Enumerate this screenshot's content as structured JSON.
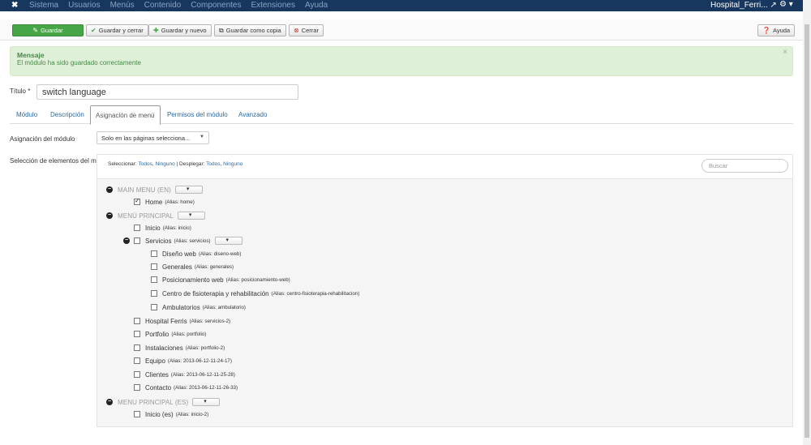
{
  "navbar": {
    "logo": "✖",
    "menu": [
      "Sistema",
      "Usuarios",
      "Menús",
      "Contenido",
      "Componentes",
      "Extensiones",
      "Ayuda"
    ],
    "site": "Hospital_Ferri... ↗",
    "gear": "⚙ ▾"
  },
  "toolbar": {
    "save": "Guardar",
    "save_close": "Guardar y cerrar",
    "save_new": "Guardar y nuevo",
    "save_copy": "Guardar como copia",
    "close": "Cerrar",
    "help": "Ayuda"
  },
  "message": {
    "heading": "Mensaje",
    "text": "El módulo ha sido guardado correctamente",
    "close": "×"
  },
  "form": {
    "title_label": "Título *",
    "title_value": "switch language",
    "assignment_label": "Asignación del módulo",
    "assignment_value": "Solo en las páginas selecciona...",
    "selection_label": "Selección de elementos del menú:"
  },
  "tabs": [
    "Módulo",
    "Descripción",
    "Asignación de menú",
    "Permisos del módulo",
    "Avanzado"
  ],
  "selectors": {
    "select_label": "Seleccionar:",
    "expand_label": "Desplegar:",
    "all": "Todos",
    "none": "Ninguno",
    "comma": ",",
    "sep": "|",
    "search_placeholder": "Buscar"
  },
  "tree": {
    "main_menu_en": "MAIN MENU (EN)",
    "menu_principal": "MENÚ PRINCIPAL",
    "menu_principal_es": "MENU PRINCIPAL (ES)",
    "items": {
      "home": {
        "label": "Home",
        "alias": "(Alias: home)"
      },
      "inicio": {
        "label": "Inicio",
        "alias": "(Alias: inicio)"
      },
      "servicios": {
        "label": "Servicios",
        "alias": "(Alias: servicios)"
      },
      "diseno": {
        "label": "Diseño web",
        "alias": "(Alias: diseno-web)"
      },
      "generales": {
        "label": "Generales",
        "alias": "(Alias: generales)"
      },
      "posicionamiento": {
        "label": "Posicionamiento web",
        "alias": "(Alias: posicionamiento-web)"
      },
      "fisioterapia": {
        "label": "Centro de fisioterapia y rehabilitación",
        "alias": "(Alias: centro-fisioterapia-rehabilitacion)"
      },
      "ambulatorios": {
        "label": "Ambulatorios",
        "alias": "(Alias: ambulatorio)"
      },
      "hospital": {
        "label": "Hospital Ferris",
        "alias": "(Alias: servicios-2)"
      },
      "portfolio": {
        "label": "Portfolio",
        "alias": "(Alias: portfolio)"
      },
      "instalaciones": {
        "label": "Instalaciones",
        "alias": "(Alias: portfolio-2)"
      },
      "equipo": {
        "label": "Equipo",
        "alias": "(Alias: 2013-06-12-11-24-17)"
      },
      "clientes": {
        "label": "Clientes",
        "alias": "(Alias: 2013-06-12-11-25-28)"
      },
      "contacto": {
        "label": "Contacto",
        "alias": "(Alias: 2013-06-12-11-26-33)"
      },
      "inicio_es": {
        "label": "Inicio (es)",
        "alias": "(Alias: inicio-2)"
      }
    }
  }
}
